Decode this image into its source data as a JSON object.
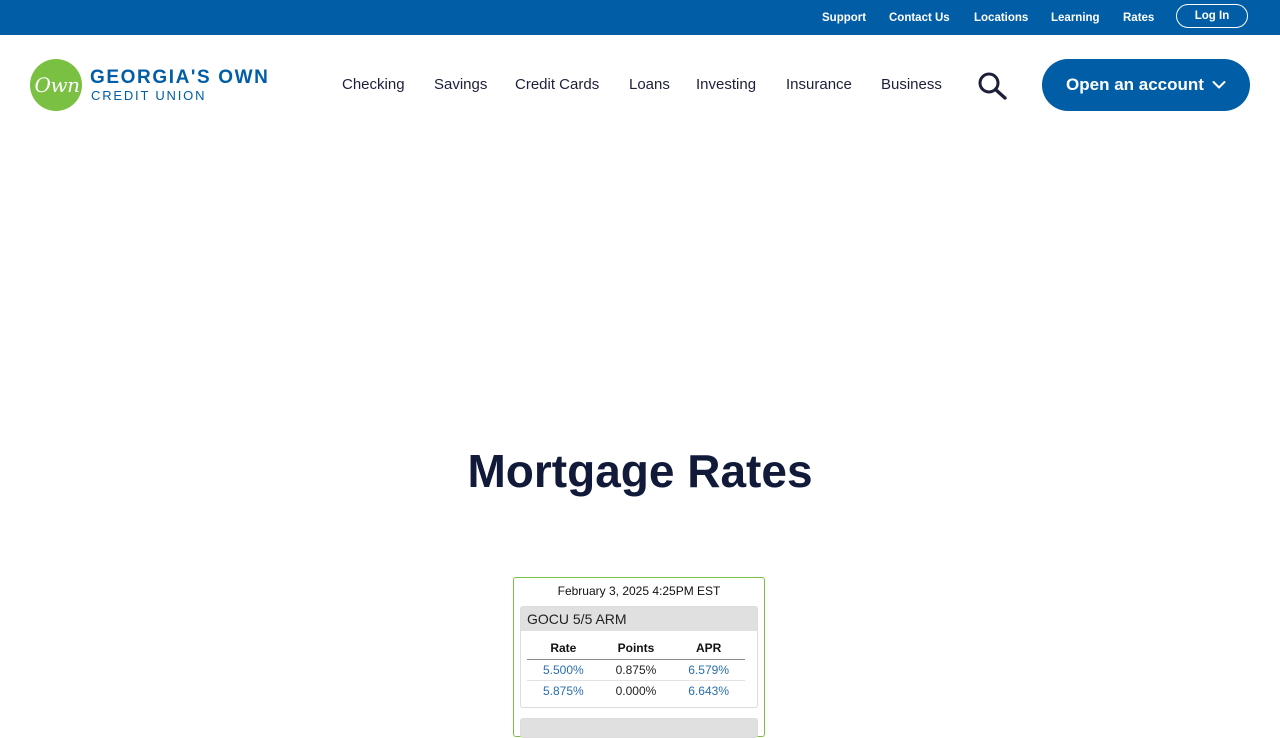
{
  "colors": {
    "brand_blue": "#005da6",
    "brand_green": "#7ac143",
    "heading": "#121a3a",
    "link": "#2a6eaf"
  },
  "utility_nav": {
    "links": [
      "Support",
      "Contact Us",
      "Locations",
      "Learning",
      "Rates"
    ],
    "login_label": "Log In"
  },
  "logo": {
    "mark": "Own",
    "line1": "GEORGIA'S OWN",
    "line2": "CREDIT UNION"
  },
  "main_nav": {
    "items": [
      "Checking",
      "Savings",
      "Credit Cards",
      "Loans",
      "Investing",
      "Insurance",
      "Business"
    ],
    "search_icon": "search-icon",
    "open_account_label": "Open an account",
    "open_account_icon": "chevron-down-icon"
  },
  "page": {
    "title": "Mortgage Rates"
  },
  "rates_widget": {
    "timestamp": "February 3, 2025 4:25PM EST",
    "product": {
      "name": "GOCU 5/5 ARM",
      "columns": [
        "Rate",
        "Points",
        "APR"
      ],
      "rows": [
        [
          "5.500%",
          "0.875%",
          "6.579%"
        ],
        [
          "5.875%",
          "0.000%",
          "6.643%"
        ]
      ]
    }
  }
}
